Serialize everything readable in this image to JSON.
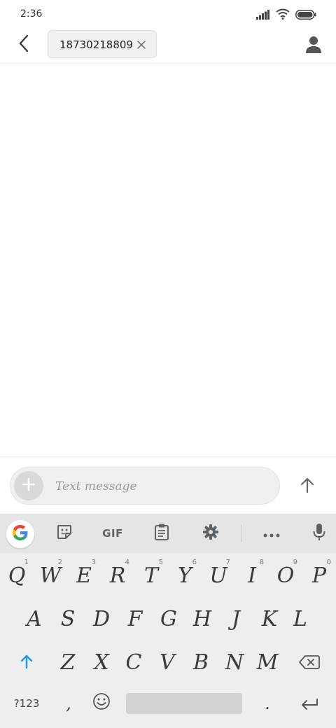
{
  "status_bar": {
    "time": "2:36",
    "icons": [
      "signal-icon",
      "wifi-icon",
      "battery-icon"
    ]
  },
  "header": {
    "back_icon": "chevron-left-icon",
    "recipient": "18730218809",
    "clear_icon": "close-icon",
    "contact_icon": "person-icon"
  },
  "composer": {
    "placeholder": "Text message",
    "value": "",
    "add_icon": "plus-icon",
    "send_icon": "arrow-up-icon"
  },
  "keyboard": {
    "toolbar": {
      "google": "google-icon",
      "sticker": "sticker-icon",
      "gif_label": "GIF",
      "clipboard": "clipboard-icon",
      "settings": "gear-icon",
      "more": "more-icon",
      "mic": "microphone-icon"
    },
    "row1": [
      {
        "label": "Q",
        "hint": "1"
      },
      {
        "label": "W",
        "hint": "2"
      },
      {
        "label": "E",
        "hint": "3"
      },
      {
        "label": "R",
        "hint": "4"
      },
      {
        "label": "T",
        "hint": "5"
      },
      {
        "label": "Y",
        "hint": "6"
      },
      {
        "label": "U",
        "hint": "7"
      },
      {
        "label": "I",
        "hint": "8"
      },
      {
        "label": "O",
        "hint": "9"
      },
      {
        "label": "P",
        "hint": "0"
      }
    ],
    "row2": [
      "A",
      "S",
      "D",
      "F",
      "G",
      "H",
      "J",
      "K",
      "L"
    ],
    "row3": [
      "Z",
      "X",
      "C",
      "V",
      "B",
      "N",
      "M"
    ],
    "symbols_label": "?123",
    "comma_label": ",",
    "period_label": ".",
    "colors": {
      "shift_accent": "#2196f3",
      "keyboard_bg": "#eeeeee",
      "toolbar_bg": "#e5e5e5"
    }
  }
}
